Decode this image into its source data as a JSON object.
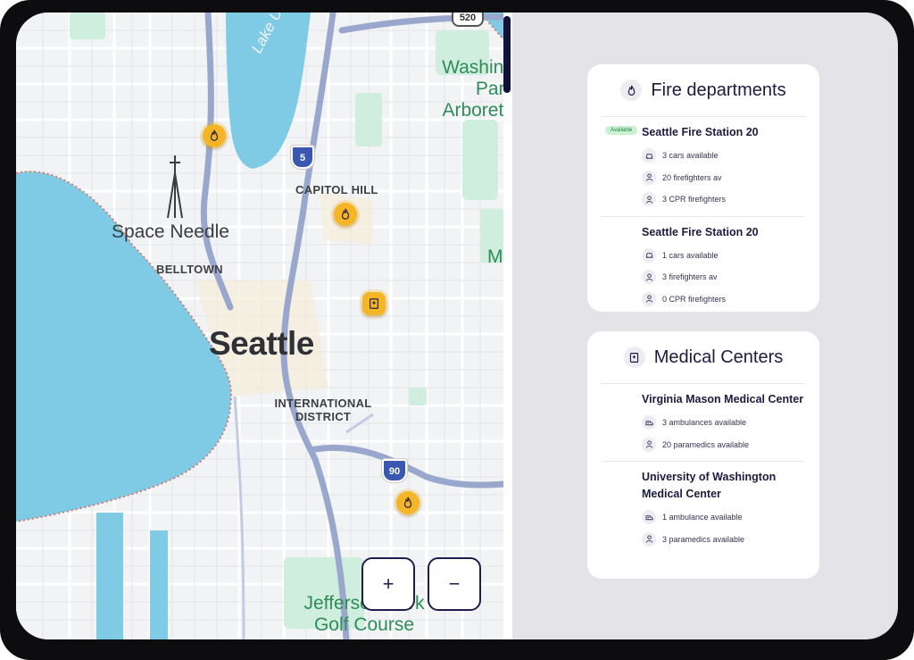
{
  "map": {
    "labels": {
      "seattle": "Seattle",
      "space_needle": "Space Needle",
      "belltown": "BELLTOWN",
      "capitol_hill": "CAPITOL HILL",
      "international_district_line1": "INTERNATIONAL",
      "international_district_line2": "DISTRICT",
      "lake_union": "Lake Union",
      "washington_park_line1": "Washing",
      "washington_park_line2": "Park",
      "washington_park_line3": "Arboretu",
      "jefferson_line1": "Jefferson Park",
      "jefferson_line2": "Golf Course",
      "m_label": "M"
    },
    "shields": {
      "i5": "5",
      "i90": "90",
      "sr520": "520"
    },
    "zoom_in_label": "+",
    "zoom_out_label": "−",
    "colors": {
      "water": "#7fcbe6",
      "park": "#cfeedd",
      "highway": "#9aa7cc",
      "marker": "#f4b527",
      "accent": "#1f1d4d"
    }
  },
  "fire_panel": {
    "title": "Fire departments",
    "icon": "flame-icon",
    "stations": [
      {
        "name": "Seattle Fire Station 20",
        "badge": "Available",
        "rows": [
          {
            "icon": "car-icon",
            "text": "3 cars available"
          },
          {
            "icon": "person-icon",
            "text": "20 firefighters av"
          },
          {
            "icon": "person-icon",
            "text": "3 CPR firefighters"
          }
        ]
      },
      {
        "name": "Seattle Fire Station 20",
        "badge": "",
        "rows": [
          {
            "icon": "car-icon",
            "text": "1 cars available"
          },
          {
            "icon": "person-icon",
            "text": "3 firefighters av"
          },
          {
            "icon": "person-icon",
            "text": "0 CPR firefighters"
          }
        ]
      }
    ]
  },
  "medical_panel": {
    "title": "Medical Centers",
    "icon": "hospital-icon",
    "centers": [
      {
        "name": "Virginia Mason Medical Center",
        "rows": [
          {
            "icon": "ambulance-icon",
            "text": "3 ambulances available"
          },
          {
            "icon": "person-icon",
            "text": "20 paramedics available"
          }
        ]
      },
      {
        "name": "University of Washington Medical Center",
        "rows": [
          {
            "icon": "ambulance-icon",
            "text": "1 ambulance available"
          },
          {
            "icon": "person-icon",
            "text": "3 paramedics available"
          }
        ]
      }
    ]
  }
}
